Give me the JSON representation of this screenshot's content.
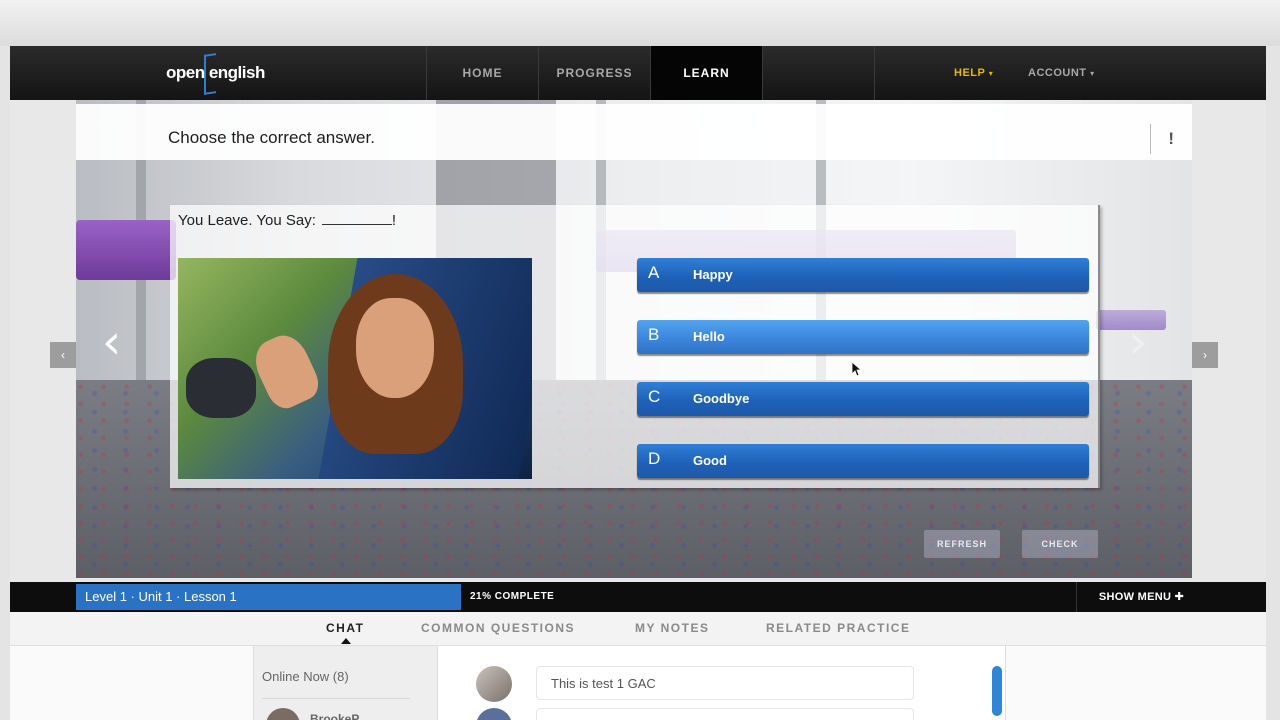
{
  "nav": {
    "logo_text": "open english",
    "items": [
      {
        "label": "HOME"
      },
      {
        "label": "PROGRESS"
      },
      {
        "label": "LEARN"
      }
    ],
    "help_label": "HELP",
    "account_label": "ACCOUNT",
    "caret": "▾"
  },
  "exercise": {
    "instruction": "Choose the correct answer.",
    "alert_icon": "!",
    "question": "You Leave. You Say:",
    "question_end": "!",
    "answers": [
      {
        "letter": "A",
        "label": "Happy"
      },
      {
        "letter": "B",
        "label": "Hello"
      },
      {
        "letter": "C",
        "label": "Goodbye"
      },
      {
        "letter": "D",
        "label": "Good"
      }
    ],
    "refresh_label": "REFRESH",
    "check_label": "CHECK",
    "prev_glyph": "‹",
    "next_glyph": "›",
    "prev_small_glyph": "‹",
    "next_small_glyph": "›"
  },
  "progress": {
    "breadcrumb": "Level 1 · Unit 1 · Lesson 1",
    "percent_text": "21% COMPLETE",
    "percent": 21,
    "show_menu": "SHOW MENU ✚"
  },
  "tabs": [
    {
      "label": "CHAT"
    },
    {
      "label": "COMMON QUESTIONS"
    },
    {
      "label": "MY NOTES"
    },
    {
      "label": "RELATED PRACTICE"
    }
  ],
  "chat": {
    "online_now": "Online Now (8)",
    "first_user": "BrookeP",
    "messages": [
      {
        "text": "This is test 1 GAC"
      }
    ]
  },
  "colors": {
    "accent_blue": "#2a73c4",
    "help_gold": "#e6b800",
    "nav_bg": "#141414"
  }
}
